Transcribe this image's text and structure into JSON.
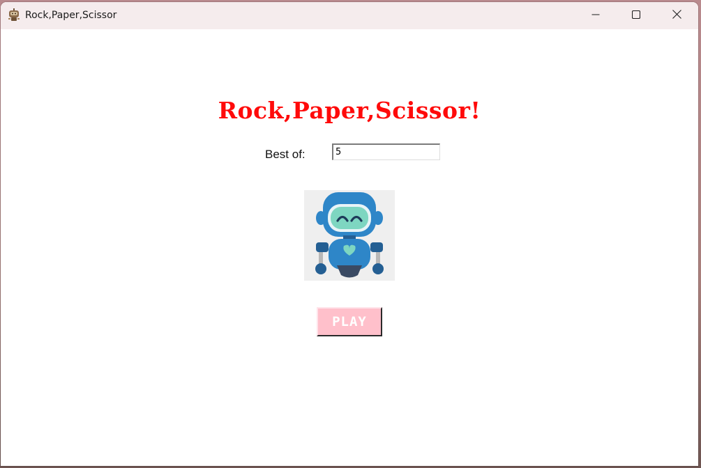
{
  "window": {
    "title": "Rock,Paper,Scissor",
    "controls": {
      "minimize_icon": "minimize-icon",
      "maximize_icon": "maximize-icon",
      "close_icon": "close-icon"
    },
    "app_icon": "robot-app-icon"
  },
  "main": {
    "heading": "Rock,Paper,Scissor!",
    "best_of_label": "Best of:",
    "best_of_value": "5",
    "image": "robot-illustration",
    "play_label": "PLAY"
  },
  "colors": {
    "heading": "#ff0a0a",
    "play_button_bg": "#ffc0cb",
    "play_button_text": "#ffffff",
    "titlebar_bg": "#f5eced",
    "robot_blue": "#2e86c8",
    "robot_visor": "#7ed6c1"
  }
}
